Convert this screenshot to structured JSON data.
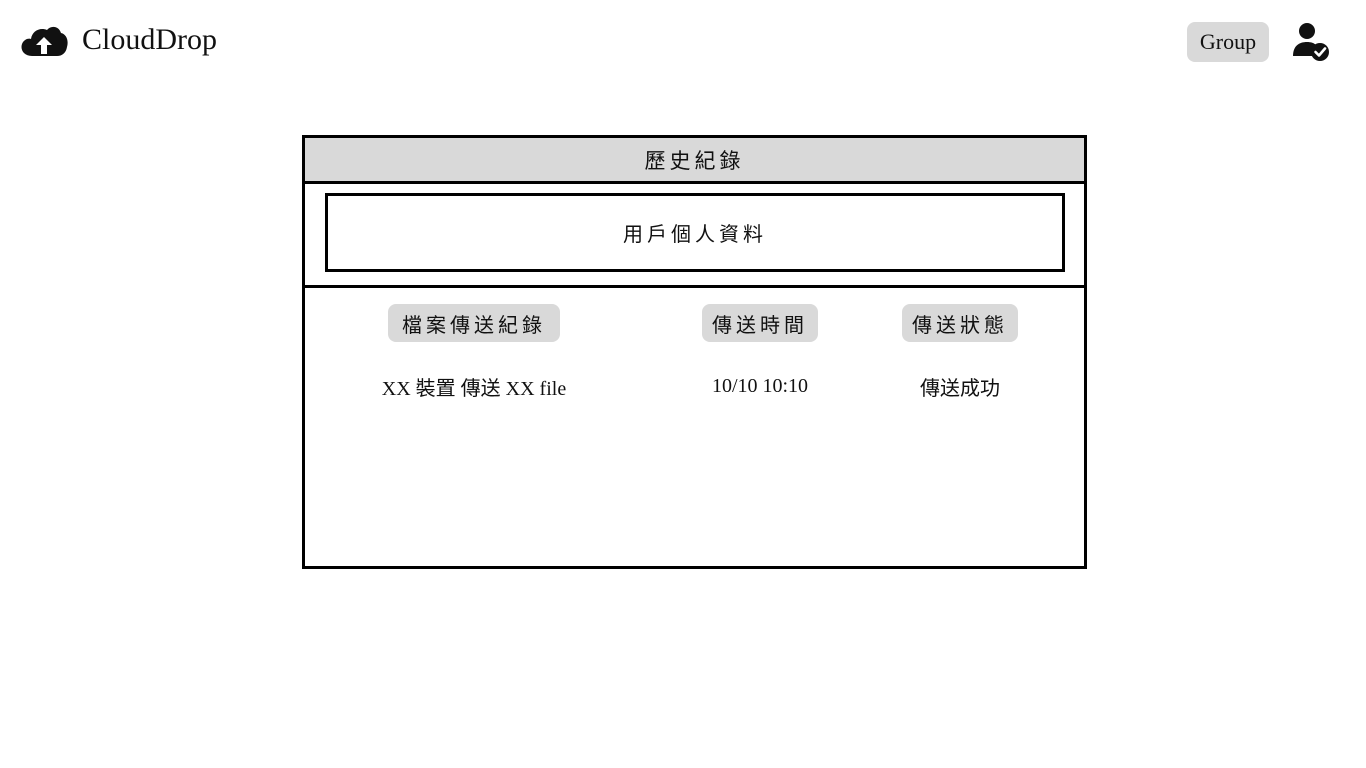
{
  "header": {
    "brand": "CloudDrop",
    "logo_icon": "cloud-upload-icon",
    "group_label": "Group",
    "user_icon": "user-verified-icon"
  },
  "history": {
    "title": "歷史紀錄",
    "profile_label": "用戶個人資料",
    "columns": [
      "檔案傳送紀錄",
      "傳送時間",
      "傳送狀態"
    ],
    "rows": [
      {
        "record": "XX 裝置 傳送 XX  file",
        "time": "10/10 10:10",
        "status": "傳送成功"
      }
    ]
  },
  "colors": {
    "header_bg": "#d9d9d9",
    "border": "#000000"
  }
}
